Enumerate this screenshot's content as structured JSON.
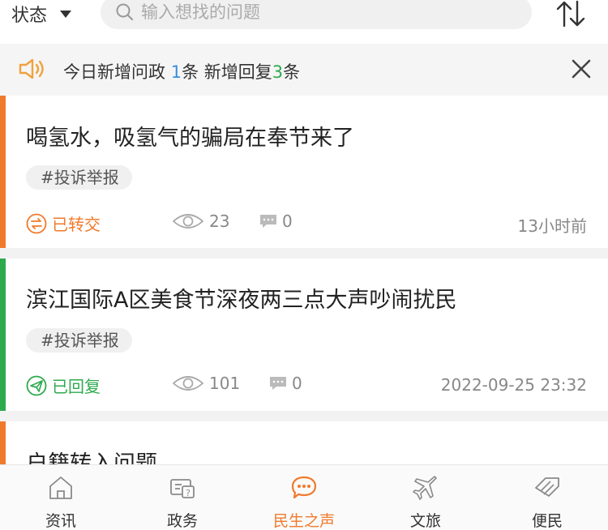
{
  "topbar": {
    "status_label": "状态",
    "search_placeholder": "输入想找的问题"
  },
  "notice": {
    "prefix": "今日新增问政 ",
    "count_questions": "1",
    "middle": "条 新增回复",
    "count_replies": "3",
    "suffix": "条"
  },
  "colors": {
    "accent": "#f07a2c",
    "transferred_bar": "#f07a2c",
    "replied_bar": "#2eaa4e",
    "blue_count": "#3a8fe0",
    "green_count": "#2eaa4e"
  },
  "items": [
    {
      "title": "喝氢水，吸氢气的骗局在奉节来了",
      "tag": "#投诉举报",
      "status": "已转交",
      "status_icon": "transfer-icon",
      "views": "23",
      "comments": "0",
      "time": "13小时前"
    },
    {
      "title": "滨江国际A区美食节深夜两三点大声吵闹扰民",
      "tag": "#投诉举报",
      "status": "已回复",
      "status_icon": "reply-icon",
      "views": "101",
      "comments": "0",
      "time": "2022-09-25 23:32"
    },
    {
      "title": "户籍转入问题"
    }
  ],
  "tabs": [
    {
      "label": "资讯",
      "icon": "home-icon"
    },
    {
      "label": "政务",
      "icon": "government-icon"
    },
    {
      "label": "民生之声",
      "icon": "chat-bubble-icon",
      "active": true
    },
    {
      "label": "文旅",
      "icon": "plane-icon"
    },
    {
      "label": "便民",
      "icon": "service-icon"
    }
  ]
}
